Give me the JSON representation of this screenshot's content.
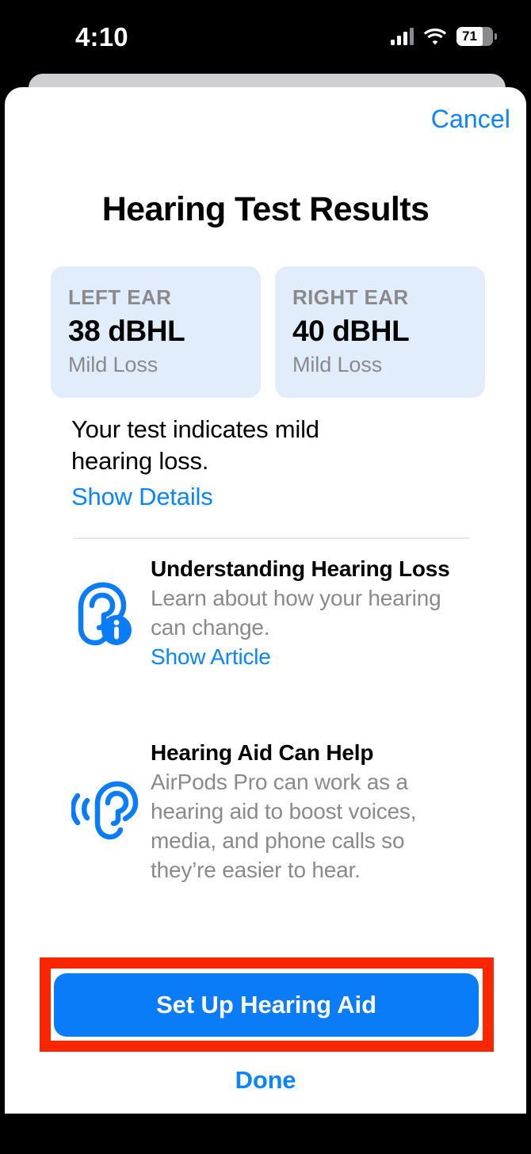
{
  "status_bar": {
    "time": "4:10",
    "cellular_icon": "cellular-signal-icon",
    "wifi_icon": "wifi-icon",
    "battery_percent": "71"
  },
  "sheet": {
    "cancel_label": "Cancel",
    "title": "Hearing Test Results",
    "ear_results": [
      {
        "label": "LEFT EAR",
        "value": "38 dBHL",
        "severity": "Mild Loss"
      },
      {
        "label": "RIGHT EAR",
        "value": "40 dBHL",
        "severity": "Mild Loss"
      }
    ],
    "summary": {
      "text": "Your test indicates mild hearing loss.",
      "details_link": "Show Details"
    },
    "info_rows": [
      {
        "icon": "ear-info-icon",
        "title": "Understanding Hearing Loss",
        "description": "Learn about how your hearing can change.",
        "link": "Show Article"
      },
      {
        "icon": "ear-sound-waves-icon",
        "title": "Hearing Aid Can Help",
        "description": "AirPods Pro can work as a hearing aid to boost voices, media, and phone calls so they’re easier to hear.",
        "link": ""
      }
    ],
    "primary_button": "Set Up Hearing Aid",
    "secondary_button": "Done"
  },
  "colors": {
    "accent_blue": "#0a84ff",
    "button_blue": "#0a7cf7",
    "card_blue": "#e2edfb",
    "highlight_red": "#fa2600",
    "muted_gray": "#8a8a8e"
  }
}
